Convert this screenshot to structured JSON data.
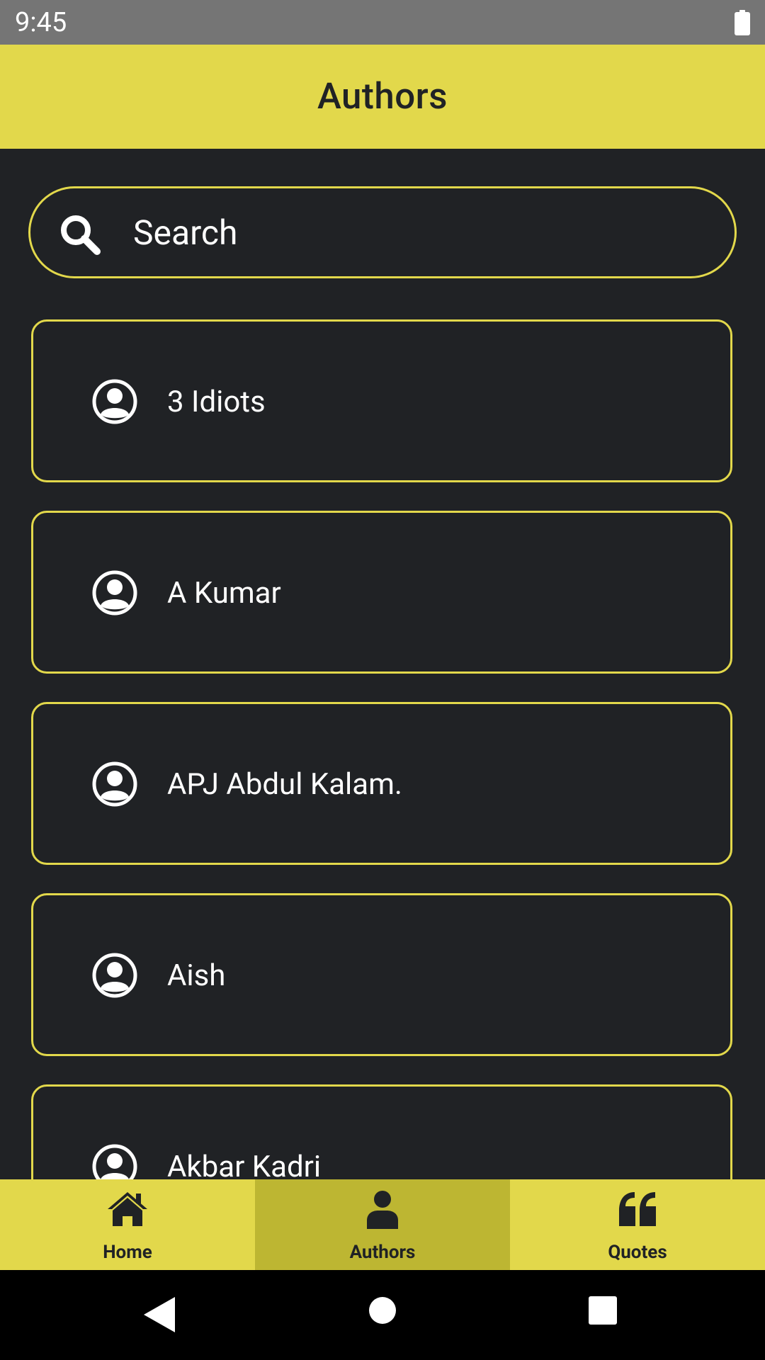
{
  "status_bar": {
    "time": "9:45"
  },
  "app_bar": {
    "title": "Authors"
  },
  "search": {
    "placeholder": "Search",
    "value": ""
  },
  "authors": [
    {
      "name": "3 Idiots"
    },
    {
      "name": "A Kumar"
    },
    {
      "name": "APJ Abdul Kalam."
    },
    {
      "name": "Aish"
    },
    {
      "name": "Akbar Kadri"
    }
  ],
  "bottom_nav": {
    "items": [
      {
        "label": "Home",
        "icon": "home-icon"
      },
      {
        "label": "Authors",
        "icon": "user-icon",
        "active": true
      },
      {
        "label": "Quotes",
        "icon": "quote-icon"
      }
    ]
  },
  "colors": {
    "accent": "#e2d84b",
    "accent_active": "#bdb632",
    "background": "#202225",
    "status_bar": "#757575"
  }
}
